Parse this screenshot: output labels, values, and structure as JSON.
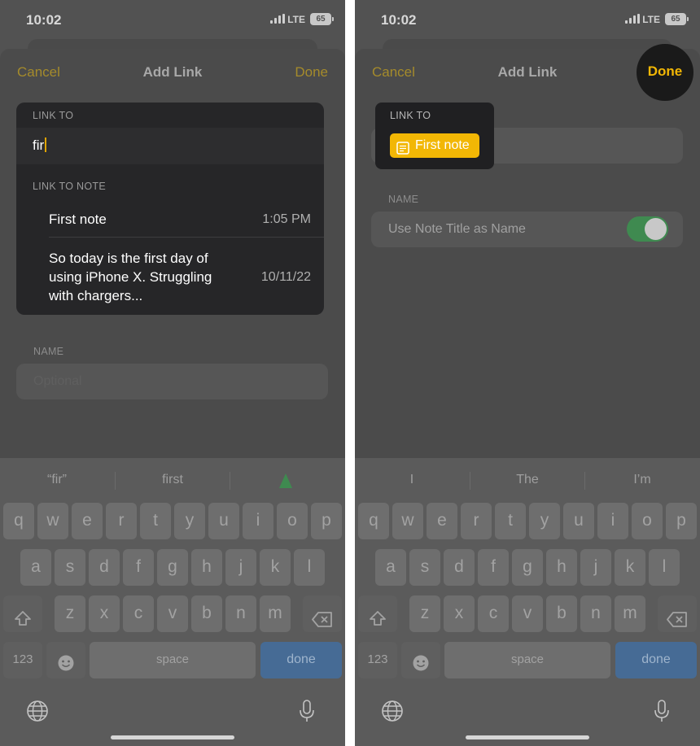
{
  "status": {
    "time": "10:02",
    "network": "LTE",
    "battery": "65"
  },
  "left": {
    "nav": {
      "cancel": "Cancel",
      "title": "Add Link",
      "done": "Done"
    },
    "link_to_label": "LINK TO",
    "typed_value": "fir",
    "link_to_note_label": "LINK TO NOTE",
    "notes": [
      {
        "title": "First note",
        "date": "1:05 PM"
      },
      {
        "line1": "So today is the first day of",
        "line2": "using iPhone X. Struggling",
        "line3": "with chargers...",
        "date": "10/11/22"
      }
    ],
    "name_label": "NAME",
    "name_placeholder": "Optional",
    "suggestions": [
      "“fir”",
      "first"
    ]
  },
  "right": {
    "nav": {
      "cancel": "Cancel",
      "title": "Add Link",
      "done": "Done"
    },
    "link_to_label": "LINK TO",
    "chip_text": "First note",
    "name_label": "NAME",
    "toggle_label": "Use Note Title as Name",
    "toggle_on": true,
    "suggestions": [
      "I",
      "The",
      "I’m"
    ]
  },
  "keyboard": {
    "row1": [
      "q",
      "w",
      "e",
      "r",
      "t",
      "y",
      "u",
      "i",
      "o",
      "p"
    ],
    "row2": [
      "a",
      "s",
      "d",
      "f",
      "g",
      "h",
      "j",
      "k",
      "l"
    ],
    "row3": [
      "z",
      "x",
      "c",
      "v",
      "b",
      "n",
      "m"
    ],
    "numbers_key": "123",
    "space_key": "space",
    "done_key": "done"
  },
  "colors": {
    "accent": "#f2b705",
    "toggle_on": "#3f8a50",
    "done_key": "#466b95"
  },
  "icons": [
    "shift-icon",
    "delete-icon",
    "emoji-icon",
    "globe-icon",
    "microphone-icon",
    "note-icon",
    "sparkle-icon"
  ]
}
